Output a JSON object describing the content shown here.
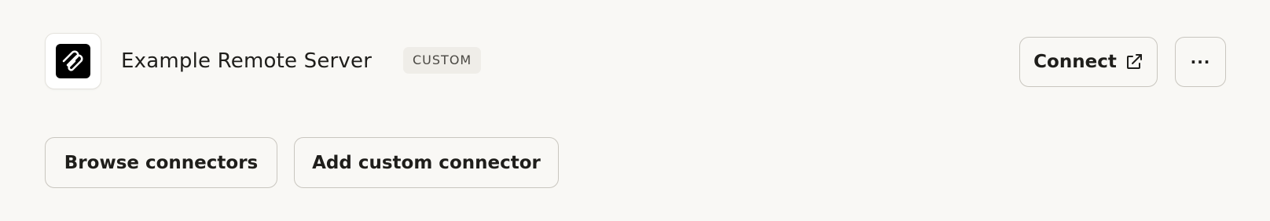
{
  "server": {
    "logo_icon": "paperclip-icon",
    "name": "Example Remote Server",
    "badge": "CUSTOM"
  },
  "actions": {
    "connect_label": "Connect",
    "connect_icon": "external-link-icon",
    "more_label": "···"
  },
  "footer": {
    "browse_label": "Browse connectors",
    "add_label": "Add custom connector"
  },
  "colors": {
    "background": "#f9f8f5",
    "border": "#c9c6bf",
    "badge_bg": "#efede8",
    "logo_bg": "#000000"
  }
}
